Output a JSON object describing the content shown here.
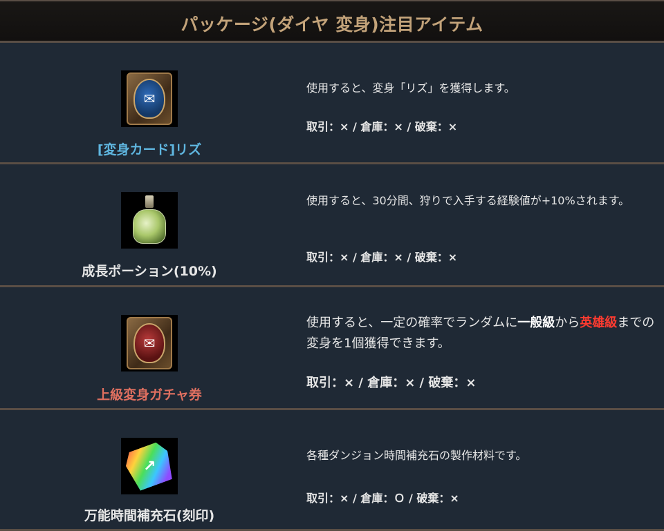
{
  "header": {
    "title": "パッケージ(ダイヤ 変身)注目アイテム"
  },
  "items": [
    {
      "name": "[変身カード]リズ",
      "name_color": "#5fb6e0",
      "icon": "blue-transform-card-icon",
      "desc": "使用すると、変身「リズ」を獲得します。",
      "trade": "取引：× / 倉庫：× / 破棄：×"
    },
    {
      "name": "成長ポーション(10%)",
      "name_color": "#e6e6e6",
      "icon": "growth-potion-icon",
      "desc": "使用すると、30分間、狩りで入手する経験値が+10%されます。",
      "trade": "取引：× / 倉庫：× / 破棄：×"
    },
    {
      "name": "上級変身ガチャ券",
      "name_color": "#e07060",
      "icon": "red-gacha-card-icon",
      "desc_parts": {
        "p1": "使用すると、一定の確率でランダムに",
        "p2": "一般級",
        "p3": "から",
        "p4": "英雄級",
        "p5": "までの変身を1個獲得できます。"
      },
      "highlight_red": "#ff3b30",
      "trade": "取引：× / 倉庫：× / 破棄：×"
    },
    {
      "name": "万能時間補充石(刻印)",
      "name_color": "#e6e6e6",
      "icon": "rainbow-gem-icon",
      "desc": "各種ダンジョン時間補充石の製作材料です。",
      "trade": "取引：× / 倉庫：Ｏ / 破棄：×"
    }
  ]
}
